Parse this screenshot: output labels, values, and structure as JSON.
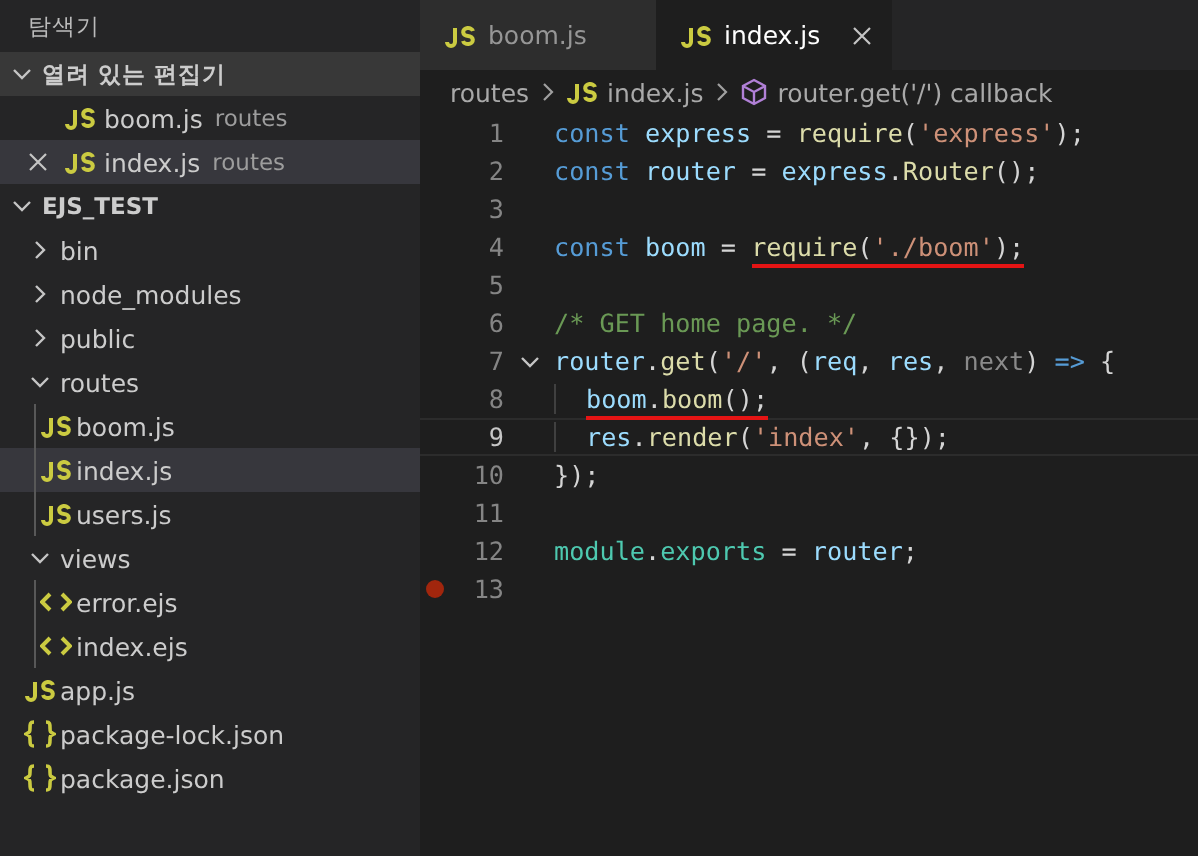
{
  "sidebar": {
    "title": "탐색기",
    "open_editors": {
      "title": "열려 있는 편집기",
      "expanded": true,
      "items": [
        {
          "name": "boom.js",
          "folder": "routes",
          "selected": false
        },
        {
          "name": "index.js",
          "folder": "routes",
          "selected": true
        }
      ]
    },
    "project": {
      "title": "EJS_TEST",
      "expanded": true,
      "items": [
        {
          "name": "bin",
          "kind": "folder",
          "expanded": false,
          "selected": false
        },
        {
          "name": "node_modules",
          "kind": "folder",
          "expanded": false,
          "selected": false
        },
        {
          "name": "public",
          "kind": "folder",
          "expanded": false,
          "selected": false
        },
        {
          "name": "routes",
          "kind": "folder",
          "expanded": true,
          "selected": false,
          "children": [
            {
              "name": "boom.js",
              "kind": "js",
              "selected": false
            },
            {
              "name": "index.js",
              "kind": "js",
              "selected": true
            },
            {
              "name": "users.js",
              "kind": "js",
              "selected": false
            }
          ]
        },
        {
          "name": "views",
          "kind": "folder",
          "expanded": true,
          "selected": false,
          "children": [
            {
              "name": "error.ejs",
              "kind": "ejs",
              "selected": false
            },
            {
              "name": "index.ejs",
              "kind": "ejs",
              "selected": false
            }
          ]
        },
        {
          "name": "app.js",
          "kind": "js",
          "selected": false
        },
        {
          "name": "package-lock.json",
          "kind": "json",
          "selected": false
        },
        {
          "name": "package.json",
          "kind": "json",
          "selected": false
        }
      ]
    }
  },
  "tabs": [
    {
      "label": "boom.js",
      "selected": false
    },
    {
      "label": "index.js",
      "selected": true
    }
  ],
  "breadcrumb": [
    {
      "kind": "folder",
      "label": "routes"
    },
    {
      "kind": "js",
      "label": "index.js"
    },
    {
      "kind": "symbol",
      "label": "router.get('/') callback"
    }
  ],
  "lines": [
    {
      "number": "1",
      "tokens": [
        {
          "text": "const",
          "kind": "kw"
        },
        {
          "text": " express",
          "kind": "var"
        },
        {
          "text": " = ",
          "kind": "p"
        },
        {
          "text": "require",
          "kind": "fn"
        },
        {
          "text": "(",
          "kind": "p"
        },
        {
          "text": "'express'",
          "kind": "str"
        },
        {
          "text": ");",
          "kind": "p"
        }
      ]
    },
    {
      "number": "2",
      "tokens": [
        {
          "text": "const",
          "kind": "kw"
        },
        {
          "text": " router",
          "kind": "var"
        },
        {
          "text": " = ",
          "kind": "p"
        },
        {
          "text": "express",
          "kind": "var"
        },
        {
          "text": ".",
          "kind": "p"
        },
        {
          "text": "Router",
          "kind": "fn"
        },
        {
          "text": "();",
          "kind": "p"
        }
      ]
    },
    {
      "number": "3"
    },
    {
      "number": "4",
      "tokens": [
        {
          "text": "const",
          "kind": "kw"
        },
        {
          "text": " boom",
          "kind": "var"
        },
        {
          "text": " = ",
          "kind": "p"
        },
        {
          "text": "require",
          "kind": "fn",
          "underlined": true
        },
        {
          "text": "(",
          "kind": "p",
          "underlined": true
        },
        {
          "text": "'./boom'",
          "kind": "str",
          "underlined": true
        },
        {
          "text": ");",
          "kind": "p",
          "underlined": true
        }
      ]
    },
    {
      "number": "5"
    },
    {
      "number": "6",
      "tokens": [
        {
          "text": "/* GET home page. */",
          "kind": "cmt"
        }
      ]
    },
    {
      "number": "7",
      "foldable": true,
      "tokens": [
        {
          "text": "router",
          "kind": "var"
        },
        {
          "text": ".",
          "kind": "p"
        },
        {
          "text": "get",
          "kind": "fn"
        },
        {
          "text": "(",
          "kind": "p"
        },
        {
          "text": "'/'",
          "kind": "str"
        },
        {
          "text": ", (",
          "kind": "p"
        },
        {
          "text": "req",
          "kind": "var"
        },
        {
          "text": ", ",
          "kind": "p"
        },
        {
          "text": "res",
          "kind": "var"
        },
        {
          "text": ", ",
          "kind": "p"
        },
        {
          "text": "next",
          "kind": "dim"
        },
        {
          "text": ") ",
          "kind": "p"
        },
        {
          "text": "=>",
          "kind": "kw"
        },
        {
          "text": " {",
          "kind": "p"
        }
      ]
    },
    {
      "number": "8",
      "indented": true,
      "tokens": [
        {
          "text": "boom",
          "kind": "var",
          "underlined": true
        },
        {
          "text": ".",
          "kind": "p",
          "underlined": true
        },
        {
          "text": "boom",
          "kind": "fn",
          "underlined": true
        },
        {
          "text": "();",
          "kind": "p",
          "underlined": true
        }
      ]
    },
    {
      "number": "9",
      "indented": true,
      "active": true,
      "tokens": [
        {
          "text": "res",
          "kind": "var"
        },
        {
          "text": ".",
          "kind": "p"
        },
        {
          "text": "render",
          "kind": "fn"
        },
        {
          "text": "(",
          "kind": "p"
        },
        {
          "text": "'index'",
          "kind": "str"
        },
        {
          "text": ", {});",
          "kind": "p"
        }
      ]
    },
    {
      "number": "10",
      "tokens": [
        {
          "text": "});",
          "kind": "p"
        }
      ]
    },
    {
      "number": "11"
    },
    {
      "number": "12",
      "tokens": [
        {
          "text": "module",
          "kind": "type"
        },
        {
          "text": ".",
          "kind": "p"
        },
        {
          "text": "exports",
          "kind": "type"
        },
        {
          "text": " = ",
          "kind": "p"
        },
        {
          "text": "router",
          "kind": "var"
        },
        {
          "text": ";",
          "kind": "p"
        }
      ]
    },
    {
      "number": "13",
      "breakpoint": true
    }
  ]
}
